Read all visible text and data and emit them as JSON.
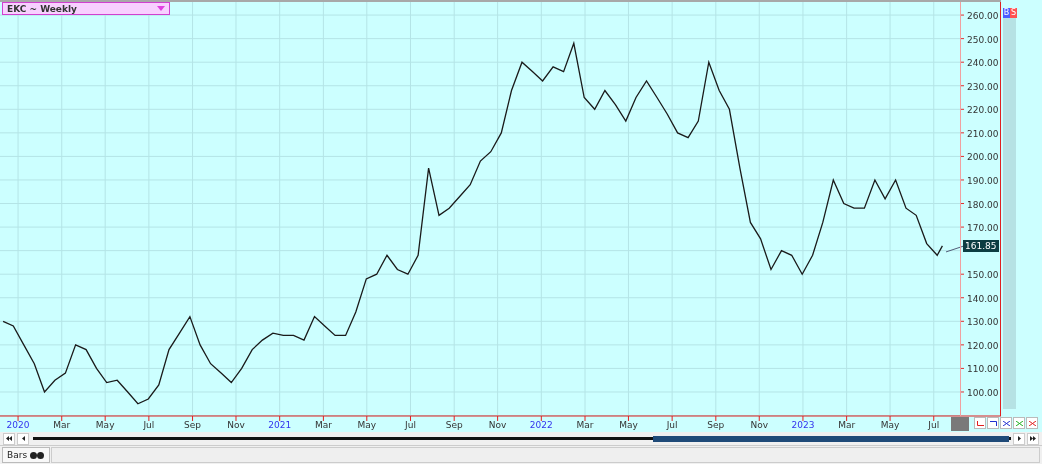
{
  "chart": {
    "title": "EKC ~ Weekly",
    "buttons": [
      {
        "label": "B",
        "kind": "buy"
      },
      {
        "label": "S",
        "kind": "sell"
      }
    ],
    "last_price": "161.85",
    "chart_data": {
      "type": "line",
      "grid": true,
      "xlim": [
        2019.931,
        2023.757
      ],
      "ylim": [
        89.8,
        266.4
      ],
      "yticks": [
        {
          "value": 100,
          "label": "100.00"
        },
        {
          "value": 110,
          "label": "110.00"
        },
        {
          "value": 120,
          "label": "120.00"
        },
        {
          "value": 130,
          "label": "130.00"
        },
        {
          "value": 140,
          "label": "140.00"
        },
        {
          "value": 150,
          "label": "150.00"
        },
        {
          "value": 170,
          "label": "170.00"
        },
        {
          "value": 180,
          "label": "180.00"
        },
        {
          "value": 190,
          "label": "190.00"
        },
        {
          "value": 200,
          "label": "200.00"
        },
        {
          "value": 210,
          "label": "210.00"
        },
        {
          "value": 220,
          "label": "220.00"
        },
        {
          "value": 230,
          "label": "230.00"
        },
        {
          "value": 240,
          "label": "240.00"
        },
        {
          "value": 250,
          "label": "250.00"
        },
        {
          "value": 260,
          "label": "260.00"
        }
      ],
      "xticks": [
        {
          "value": 2020,
          "label": "2020"
        },
        {
          "value": 2020.167,
          "label": "Mar"
        },
        {
          "value": 2020.333,
          "label": "May"
        },
        {
          "value": 2020.5,
          "label": "Jul"
        },
        {
          "value": 2020.667,
          "label": "Sep"
        },
        {
          "value": 2020.833,
          "label": "Nov"
        },
        {
          "value": 2021,
          "label": "2021"
        },
        {
          "value": 2021.167,
          "label": "Mar"
        },
        {
          "value": 2021.333,
          "label": "May"
        },
        {
          "value": 2021.5,
          "label": "Jul"
        },
        {
          "value": 2021.667,
          "label": "Sep"
        },
        {
          "value": 2021.833,
          "label": "Nov"
        },
        {
          "value": 2022,
          "label": "2022"
        },
        {
          "value": 2022.167,
          "label": "Mar"
        },
        {
          "value": 2022.333,
          "label": "May"
        },
        {
          "value": 2022.5,
          "label": "Jul"
        },
        {
          "value": 2022.667,
          "label": "Sep"
        },
        {
          "value": 2022.833,
          "label": "Nov"
        },
        {
          "value": 2023,
          "label": "2023"
        },
        {
          "value": 2023.167,
          "label": "Mar"
        },
        {
          "value": 2023.333,
          "label": "May"
        },
        {
          "value": 2023.5,
          "label": "Jul"
        }
      ],
      "x": [
        2019.943,
        2019.982,
        2020.022,
        2020.062,
        2020.101,
        2020.141,
        2020.181,
        2020.22,
        2020.26,
        2020.3,
        2020.339,
        2020.379,
        2020.419,
        2020.458,
        2020.498,
        2020.538,
        2020.577,
        2020.617,
        2020.657,
        2020.696,
        2020.736,
        2020.776,
        2020.815,
        2020.855,
        2020.895,
        2020.934,
        2020.974,
        2021.014,
        2021.053,
        2021.093,
        2021.133,
        2021.172,
        2021.212,
        2021.252,
        2021.291,
        2021.331,
        2021.371,
        2021.41,
        2021.45,
        2021.49,
        2021.529,
        2021.569,
        2021.609,
        2021.648,
        2021.688,
        2021.728,
        2021.767,
        2021.807,
        2021.847,
        2021.886,
        2021.926,
        2021.966,
        2022.005,
        2022.045,
        2022.085,
        2022.124,
        2022.164,
        2022.204,
        2022.243,
        2022.283,
        2022.323,
        2022.362,
        2022.402,
        2022.442,
        2022.481,
        2022.521,
        2022.561,
        2022.6,
        2022.64,
        2022.68,
        2022.719,
        2022.759,
        2022.799,
        2022.838,
        2022.878,
        2022.918,
        2022.957,
        2022.997,
        2023.037,
        2023.076,
        2023.116,
        2023.156,
        2023.195,
        2023.235,
        2023.275,
        2023.314,
        2023.354,
        2023.394,
        2023.433,
        2023.473,
        2023.513,
        2023.533
      ],
      "series": [
        {
          "color": "#1a1a1a",
          "values": [
            130,
            128,
            120,
            112,
            100,
            105,
            108,
            120,
            118,
            110,
            104,
            105,
            100,
            95,
            97,
            103,
            118,
            125,
            132,
            120,
            112,
            108,
            104,
            110,
            118,
            122,
            125,
            124,
            124,
            122,
            132,
            128,
            124,
            124,
            134,
            148,
            150,
            158,
            152,
            150,
            158,
            195,
            175,
            178,
            183,
            188,
            198,
            202,
            210,
            228,
            240,
            236,
            232,
            238,
            236,
            248,
            225,
            220,
            228,
            222,
            215,
            225,
            232,
            225,
            218,
            210,
            208,
            215,
            240,
            228,
            220,
            195,
            172,
            165,
            152,
            160,
            158,
            150,
            158,
            172,
            190,
            180,
            178,
            178,
            190,
            182,
            190,
            178,
            175,
            163,
            158,
            162
          ]
        }
      ]
    }
  },
  "tabs": [
    {
      "label": "Bars",
      "selected": true
    }
  ]
}
